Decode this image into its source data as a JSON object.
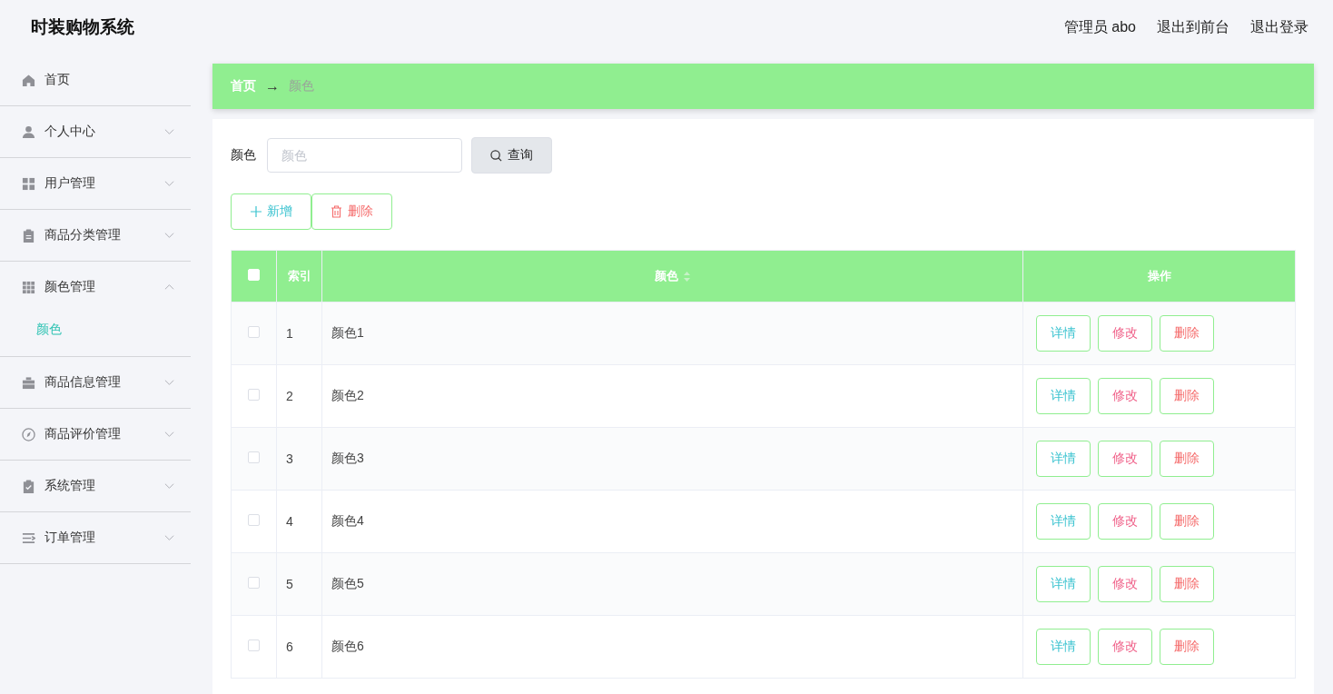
{
  "header": {
    "title": "时装购物系统",
    "links": [
      "管理员 abo",
      "退出到前台",
      "退出登录"
    ]
  },
  "sidebar": {
    "items": [
      {
        "label": "首页",
        "expandable": false
      },
      {
        "label": "个人中心",
        "expandable": true,
        "expanded": false
      },
      {
        "label": "用户管理",
        "expandable": true,
        "expanded": false
      },
      {
        "label": "商品分类管理",
        "expandable": true,
        "expanded": false
      },
      {
        "label": "颜色管理",
        "expandable": true,
        "expanded": true,
        "children": [
          {
            "label": "颜色",
            "selected": true
          }
        ]
      },
      {
        "label": "商品信息管理",
        "expandable": true,
        "expanded": false
      },
      {
        "label": "商品评价管理",
        "expandable": true,
        "expanded": false
      },
      {
        "label": "系统管理",
        "expandable": true,
        "expanded": false
      },
      {
        "label": "订单管理",
        "expandable": true,
        "expanded": false
      }
    ]
  },
  "breadcrumb": {
    "home": "首页",
    "separator": "→",
    "current": "颜色"
  },
  "search": {
    "label": "颜色",
    "placeholder": "颜色",
    "button": "查询"
  },
  "actions": [
    "新增",
    "删除"
  ],
  "table": {
    "select_all_checked": false,
    "columns": [
      "索引",
      "颜色",
      "操作"
    ],
    "rows": [
      {
        "checked": false,
        "index": "1",
        "name": "颜色1",
        "buttons": [
          "详情",
          "修改",
          "删除"
        ]
      },
      {
        "checked": false,
        "index": "2",
        "name": "颜色2",
        "buttons": [
          "详情",
          "修改",
          "删除"
        ]
      },
      {
        "checked": false,
        "index": "3",
        "name": "颜色3",
        "buttons": [
          "详情",
          "修改",
          "删除"
        ]
      },
      {
        "checked": false,
        "index": "4",
        "name": "颜色4",
        "buttons": [
          "详情",
          "修改",
          "删除"
        ]
      },
      {
        "checked": false,
        "index": "5",
        "name": "颜色5",
        "buttons": [
          "详情",
          "修改",
          "删除"
        ]
      },
      {
        "checked": false,
        "index": "6",
        "name": "颜色6",
        "buttons": [
          "详情",
          "修改",
          "删除"
        ]
      }
    ]
  }
}
